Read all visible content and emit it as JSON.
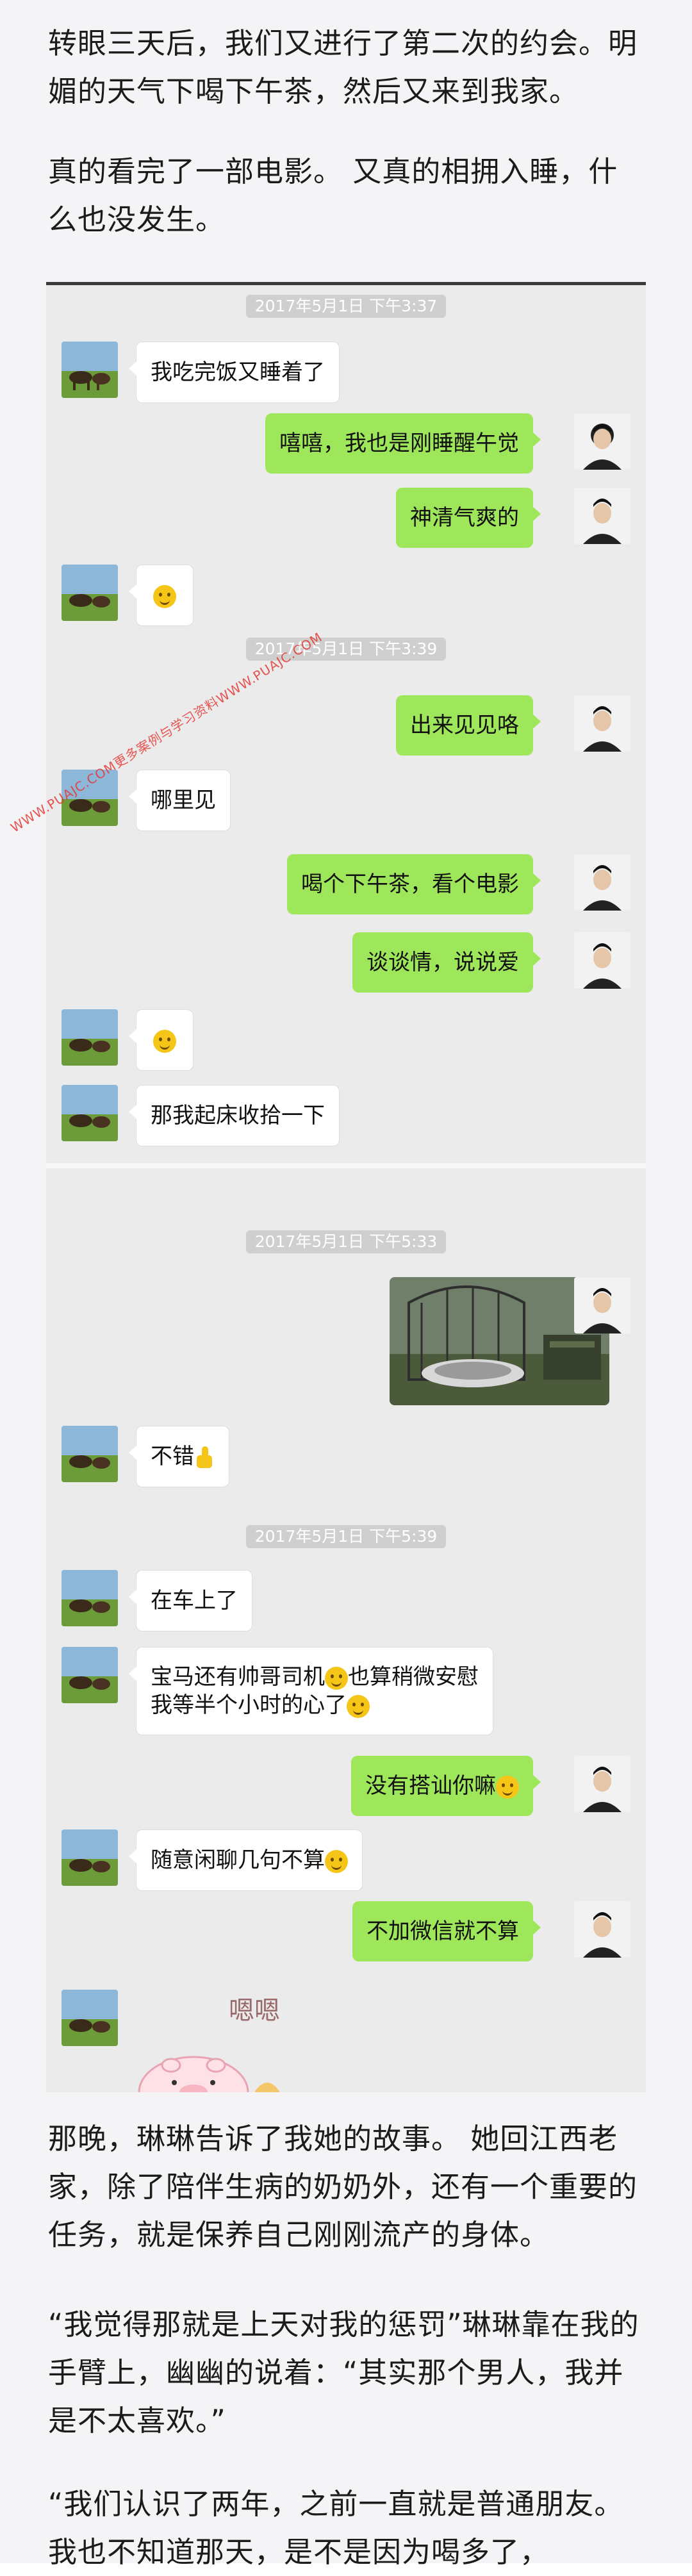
{
  "paragraphs": {
    "p1": "转眼三天后，我们又进行了第二次的约会。明媚的天气下喝下午茶，然后又来到我家。",
    "p2": "真的看完了一部电影。 又真的相拥入睡，什么也没发生。",
    "p3": "那晚，琳琳告诉了我她的故事。 她回江西老家，除了陪伴生病的奶奶外，还有一个重要的任务，就是保养自己刚刚流产的身体。",
    "p4": "“我觉得那就是上天对我的惩罚”琳琳靠在我的手臂上，幽幽的说着：“其实那个男人，我并是不太喜欢。”",
    "p5": " “我们认识了两年，之前一直就是普通朋友。我也不知道那天，是不是因为喝多了，"
  },
  "chat": {
    "timestamps": [
      "2017年5月1日 下午3:37",
      "2017年5月1日 下午3:39",
      "2017年5月1日 下午5:33",
      "2017年5月1日 下午5:39"
    ],
    "messages": [
      {
        "side": "in",
        "text": "我吃完饭又睡着了"
      },
      {
        "side": "out",
        "text": "嘻嘻，我也是刚睡醒午觉"
      },
      {
        "side": "out",
        "text": "神清气爽的"
      },
      {
        "side": "in",
        "emoji": "smile-emoji"
      },
      {
        "side": "out",
        "text": "出来见见咯"
      },
      {
        "side": "in",
        "text": "哪里见"
      },
      {
        "side": "out",
        "text": "喝个下午茶，看个电影"
      },
      {
        "side": "out",
        "text": "谈谈情，说说爱"
      },
      {
        "side": "in",
        "emoji": "wink-emoji"
      },
      {
        "side": "in",
        "text": "那我起床收拾一下"
      },
      {
        "side": "out",
        "image": "garden-photo"
      },
      {
        "side": "in",
        "text": "不错",
        "emoji": "thumbs-up-emoji"
      },
      {
        "side": "in",
        "text": "在车上了"
      },
      {
        "side": "in",
        "text_line1": "宝马还有帅哥司机",
        "text_mid": "也算稍微安慰",
        "text_line2": "我等半个小时的心了"
      },
      {
        "side": "out",
        "text": "没有搭讪你嘛"
      },
      {
        "side": "in",
        "text": "随意闲聊几句不算"
      },
      {
        "side": "out",
        "text": "不加微信就不算"
      },
      {
        "side": "in",
        "sticker": "嗯嗯"
      }
    ]
  },
  "watermark": "WWW.PUAJC.COM更多案例与学习资料WWW.PUAJC.COM",
  "colors": {
    "bubble_out": "#9fe75a",
    "bubble_in": "#ffffff",
    "chat_bg": "#ebebeb",
    "watermark": "#e53935"
  }
}
